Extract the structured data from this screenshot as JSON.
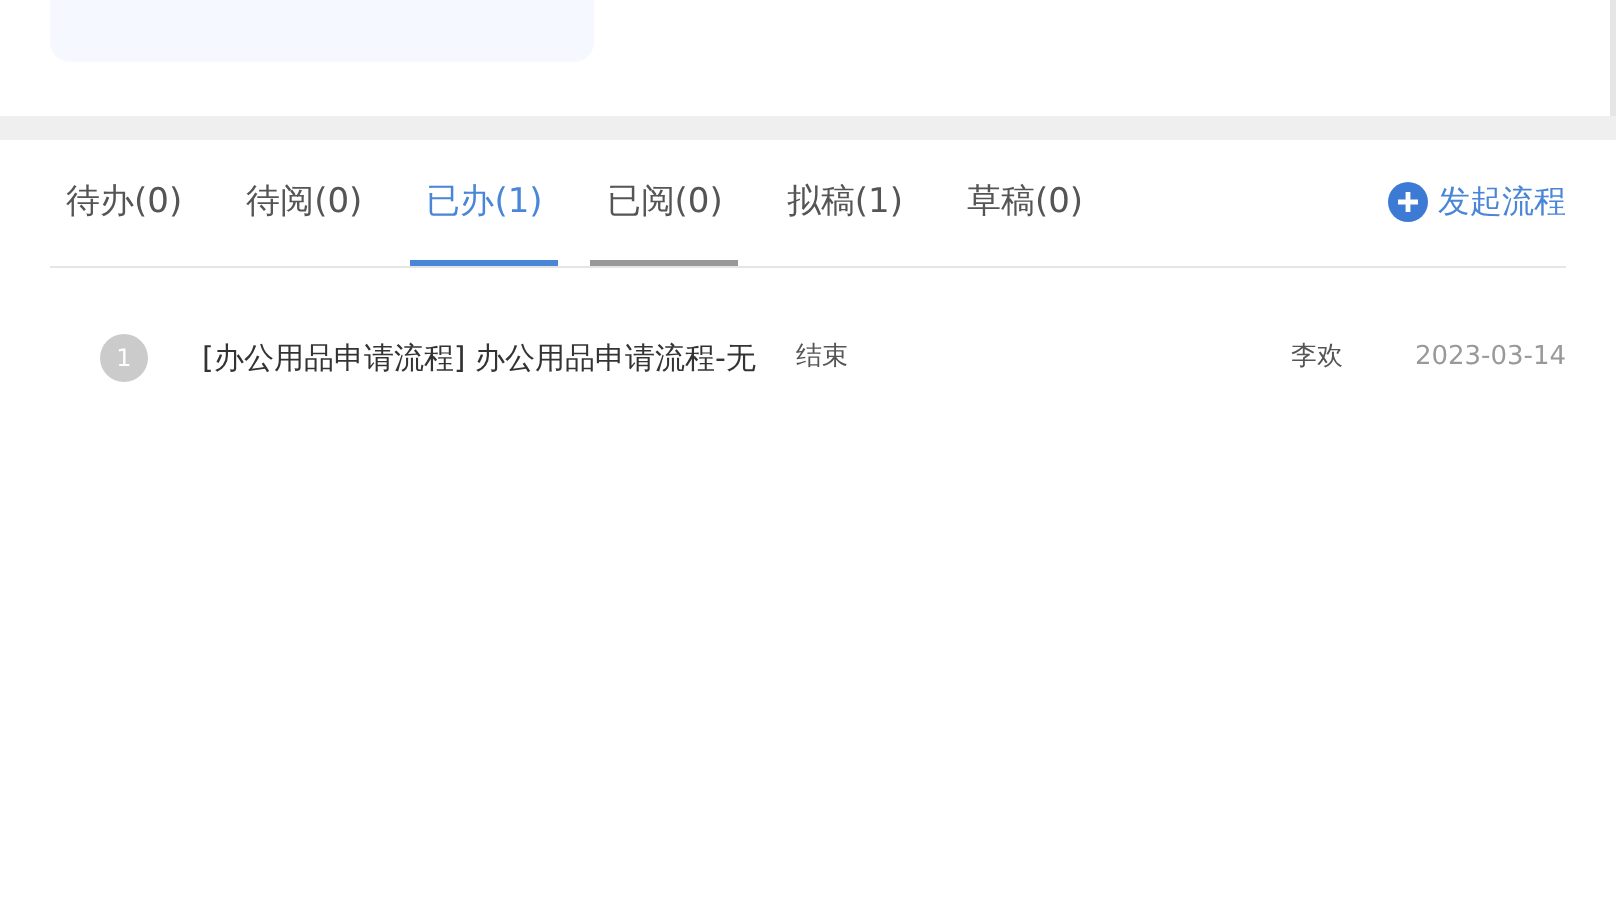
{
  "tabs": [
    {
      "label": "待办(0)",
      "selected": false,
      "hovered": false
    },
    {
      "label": "待阅(0)",
      "selected": false,
      "hovered": false
    },
    {
      "label": "已办(1)",
      "selected": true,
      "hovered": false
    },
    {
      "label": "已阅(0)",
      "selected": false,
      "hovered": true
    },
    {
      "label": "拟稿(1)",
      "selected": false,
      "hovered": false
    },
    {
      "label": "草稿(0)",
      "selected": false,
      "hovered": false
    }
  ],
  "start_button": {
    "label": "发起流程"
  },
  "rows": [
    {
      "index": "1",
      "title": "[办公用品申请流程] 办公用品申请流程-无",
      "status": "结束",
      "person": "李欢",
      "date": "2023-03-14"
    }
  ]
}
